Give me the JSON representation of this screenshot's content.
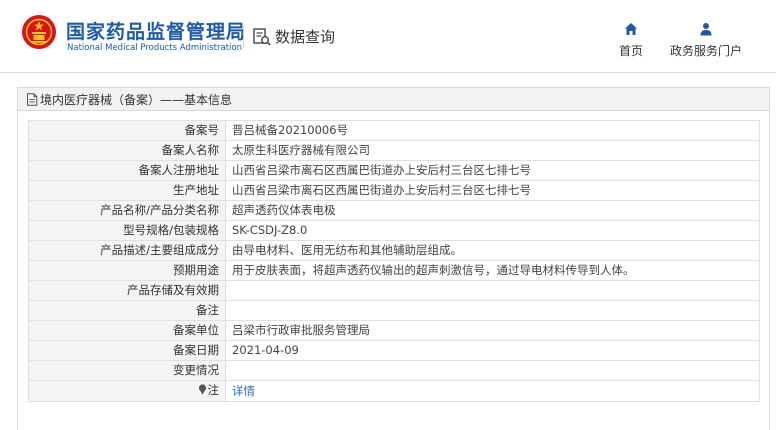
{
  "header": {
    "brand_cn": "国家药品监督管理局",
    "brand_en": "National Medical Products Administration",
    "data_query": "数据查询",
    "nav_home": "首页",
    "nav_portal": "政务服务门户",
    "brand_color": "#1f5aa6",
    "emblem_color": "#d7141a"
  },
  "panel": {
    "title": "境内医疗器械（备案）——基本信息",
    "rows": [
      {
        "label": "备案号",
        "value": "晋吕械备20210006号"
      },
      {
        "label": "备案人名称",
        "value": "太原生科医疗器械有限公司"
      },
      {
        "label": "备案人注册地址",
        "value": "山西省吕梁市离石区西属巴街道办上安后村三台区七排七号"
      },
      {
        "label": "生产地址",
        "value": "山西省吕梁市离石区西属巴街道办上安后村三台区七排七号"
      },
      {
        "label": "产品名称/产品分类名称",
        "value": "超声透药仪体表电极"
      },
      {
        "label": "型号规格/包装规格",
        "value": "SK-CSDJ-Z8.0"
      },
      {
        "label": "产品描述/主要组成成分",
        "value": "由导电材料、医用无纺布和其他辅助层组成。"
      },
      {
        "label": "预期用途",
        "value": "用于皮肤表面，将超声透药仪输出的超声刺激信号，通过导电材料传导到人体。"
      },
      {
        "label": "产品存储及有效期",
        "value": ""
      },
      {
        "label": "备注",
        "value": ""
      },
      {
        "label": "备案单位",
        "value": "吕梁市行政审批服务管理局"
      },
      {
        "label": "备案日期",
        "value": "2021-04-09"
      },
      {
        "label": "变更情况",
        "value": ""
      }
    ],
    "note_label": "注",
    "detail_link": "详情",
    "link_color": "#2c6dc6"
  }
}
